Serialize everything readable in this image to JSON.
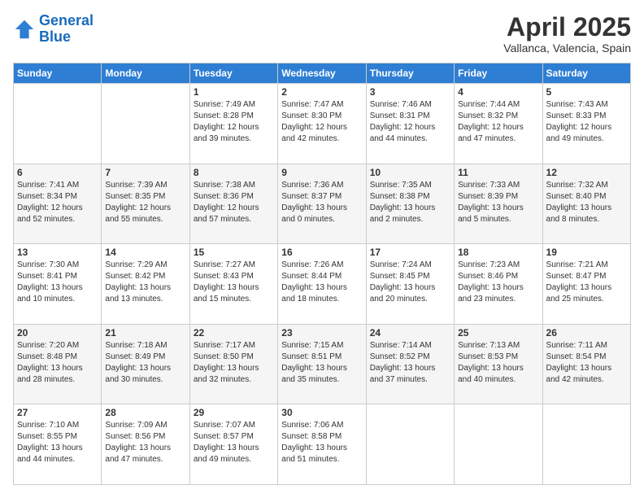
{
  "header": {
    "logo_line1": "General",
    "logo_line2": "Blue",
    "main_title": "April 2025",
    "subtitle": "Vallanca, Valencia, Spain"
  },
  "calendar": {
    "days_of_week": [
      "Sunday",
      "Monday",
      "Tuesday",
      "Wednesday",
      "Thursday",
      "Friday",
      "Saturday"
    ],
    "rows": [
      [
        {
          "day": "",
          "info": ""
        },
        {
          "day": "",
          "info": ""
        },
        {
          "day": "1",
          "info": "Sunrise: 7:49 AM\nSunset: 8:28 PM\nDaylight: 12 hours and 39 minutes."
        },
        {
          "day": "2",
          "info": "Sunrise: 7:47 AM\nSunset: 8:30 PM\nDaylight: 12 hours and 42 minutes."
        },
        {
          "day": "3",
          "info": "Sunrise: 7:46 AM\nSunset: 8:31 PM\nDaylight: 12 hours and 44 minutes."
        },
        {
          "day": "4",
          "info": "Sunrise: 7:44 AM\nSunset: 8:32 PM\nDaylight: 12 hours and 47 minutes."
        },
        {
          "day": "5",
          "info": "Sunrise: 7:43 AM\nSunset: 8:33 PM\nDaylight: 12 hours and 49 minutes."
        }
      ],
      [
        {
          "day": "6",
          "info": "Sunrise: 7:41 AM\nSunset: 8:34 PM\nDaylight: 12 hours and 52 minutes."
        },
        {
          "day": "7",
          "info": "Sunrise: 7:39 AM\nSunset: 8:35 PM\nDaylight: 12 hours and 55 minutes."
        },
        {
          "day": "8",
          "info": "Sunrise: 7:38 AM\nSunset: 8:36 PM\nDaylight: 12 hours and 57 minutes."
        },
        {
          "day": "9",
          "info": "Sunrise: 7:36 AM\nSunset: 8:37 PM\nDaylight: 13 hours and 0 minutes."
        },
        {
          "day": "10",
          "info": "Sunrise: 7:35 AM\nSunset: 8:38 PM\nDaylight: 13 hours and 2 minutes."
        },
        {
          "day": "11",
          "info": "Sunrise: 7:33 AM\nSunset: 8:39 PM\nDaylight: 13 hours and 5 minutes."
        },
        {
          "day": "12",
          "info": "Sunrise: 7:32 AM\nSunset: 8:40 PM\nDaylight: 13 hours and 8 minutes."
        }
      ],
      [
        {
          "day": "13",
          "info": "Sunrise: 7:30 AM\nSunset: 8:41 PM\nDaylight: 13 hours and 10 minutes."
        },
        {
          "day": "14",
          "info": "Sunrise: 7:29 AM\nSunset: 8:42 PM\nDaylight: 13 hours and 13 minutes."
        },
        {
          "day": "15",
          "info": "Sunrise: 7:27 AM\nSunset: 8:43 PM\nDaylight: 13 hours and 15 minutes."
        },
        {
          "day": "16",
          "info": "Sunrise: 7:26 AM\nSunset: 8:44 PM\nDaylight: 13 hours and 18 minutes."
        },
        {
          "day": "17",
          "info": "Sunrise: 7:24 AM\nSunset: 8:45 PM\nDaylight: 13 hours and 20 minutes."
        },
        {
          "day": "18",
          "info": "Sunrise: 7:23 AM\nSunset: 8:46 PM\nDaylight: 13 hours and 23 minutes."
        },
        {
          "day": "19",
          "info": "Sunrise: 7:21 AM\nSunset: 8:47 PM\nDaylight: 13 hours and 25 minutes."
        }
      ],
      [
        {
          "day": "20",
          "info": "Sunrise: 7:20 AM\nSunset: 8:48 PM\nDaylight: 13 hours and 28 minutes."
        },
        {
          "day": "21",
          "info": "Sunrise: 7:18 AM\nSunset: 8:49 PM\nDaylight: 13 hours and 30 minutes."
        },
        {
          "day": "22",
          "info": "Sunrise: 7:17 AM\nSunset: 8:50 PM\nDaylight: 13 hours and 32 minutes."
        },
        {
          "day": "23",
          "info": "Sunrise: 7:15 AM\nSunset: 8:51 PM\nDaylight: 13 hours and 35 minutes."
        },
        {
          "day": "24",
          "info": "Sunrise: 7:14 AM\nSunset: 8:52 PM\nDaylight: 13 hours and 37 minutes."
        },
        {
          "day": "25",
          "info": "Sunrise: 7:13 AM\nSunset: 8:53 PM\nDaylight: 13 hours and 40 minutes."
        },
        {
          "day": "26",
          "info": "Sunrise: 7:11 AM\nSunset: 8:54 PM\nDaylight: 13 hours and 42 minutes."
        }
      ],
      [
        {
          "day": "27",
          "info": "Sunrise: 7:10 AM\nSunset: 8:55 PM\nDaylight: 13 hours and 44 minutes."
        },
        {
          "day": "28",
          "info": "Sunrise: 7:09 AM\nSunset: 8:56 PM\nDaylight: 13 hours and 47 minutes."
        },
        {
          "day": "29",
          "info": "Sunrise: 7:07 AM\nSunset: 8:57 PM\nDaylight: 13 hours and 49 minutes."
        },
        {
          "day": "30",
          "info": "Sunrise: 7:06 AM\nSunset: 8:58 PM\nDaylight: 13 hours and 51 minutes."
        },
        {
          "day": "",
          "info": ""
        },
        {
          "day": "",
          "info": ""
        },
        {
          "day": "",
          "info": ""
        }
      ]
    ]
  }
}
